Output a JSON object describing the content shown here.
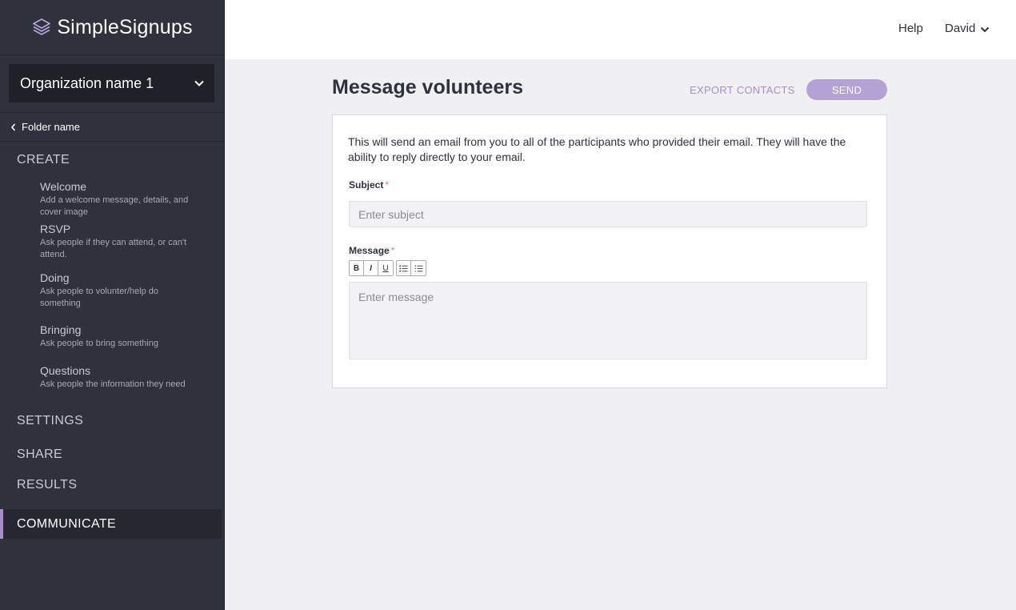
{
  "app": {
    "logo_text": "SimpleSignups"
  },
  "sidebar": {
    "org_name": "Organization name 1",
    "folder_label": "Folder name",
    "sections": {
      "create": "CREATE",
      "settings": "SETTINGS",
      "share": "SHARE",
      "results": "RESULTS",
      "communicate": "COMMUNICATE"
    },
    "steps": [
      {
        "title": "Welcome",
        "desc": "Add a welcome message, details, and cover image"
      },
      {
        "title": "RSVP",
        "desc": "Ask people if they can attend, or can't attend."
      },
      {
        "title": "Doing",
        "desc": "Ask people to volunter/help do something"
      },
      {
        "title": "Bringing",
        "desc": "Ask people to bring something"
      },
      {
        "title": "Questions",
        "desc": "Ask people the information they need"
      }
    ]
  },
  "topbar": {
    "help": "Help",
    "user": "David"
  },
  "main": {
    "title": "Message volunteers",
    "export_label": "EXPORT CONTACTS",
    "send_label": "SEND",
    "intro": "This will send an email from you to all of the participants who provided their email. They will have the ability to reply directly to your email.",
    "subject_label": "Subject",
    "subject_placeholder": "Enter subject",
    "subject_value": "",
    "message_label": "Message",
    "message_placeholder": "Enter message",
    "message_value": "",
    "required_mark": "*",
    "toolbar": {
      "bold": "B",
      "italic": "I",
      "underline": "U"
    }
  },
  "colors": {
    "accent": "#a48fc9",
    "sidebar_bg": "#2f313d",
    "send_bg": "#b5a2d4"
  }
}
